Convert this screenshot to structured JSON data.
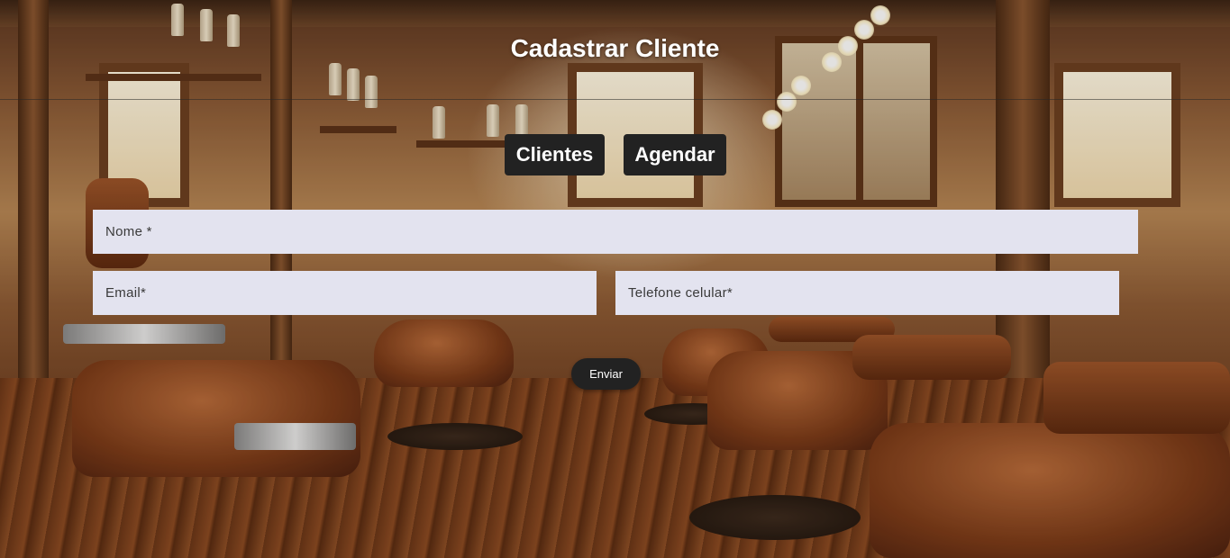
{
  "header": {
    "title": "Cadastrar Cliente"
  },
  "nav": {
    "clientes_label": "Clientes",
    "agendar_label": "Agendar"
  },
  "form": {
    "nome_placeholder": "Nome *",
    "email_placeholder": "Email*",
    "telefone_placeholder": "Telefone celular*",
    "submit_label": "Enviar"
  },
  "colors": {
    "button_bg": "#222222",
    "field_bg": "#e3e3ef",
    "title_color": "#ffffff"
  }
}
